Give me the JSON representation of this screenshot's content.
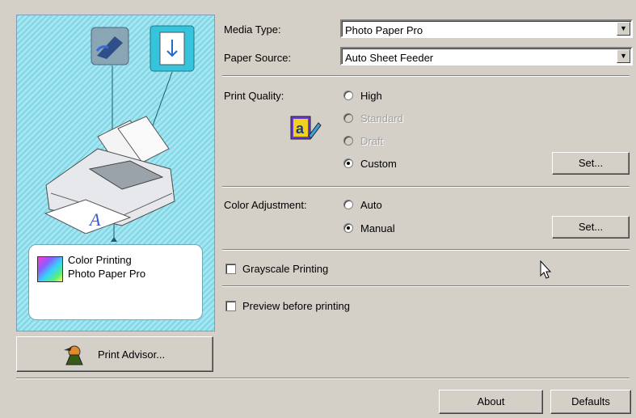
{
  "preview": {
    "info_line1": "Color Printing",
    "info_line2": "Photo Paper Pro",
    "print_advisor_label": "Print Advisor..."
  },
  "media_type": {
    "label": "Media Type:",
    "value": "Photo Paper Pro"
  },
  "paper_source": {
    "label": "Paper Source:",
    "value": "Auto Sheet Feeder"
  },
  "print_quality": {
    "label": "Print Quality:",
    "options": [
      "High",
      "Standard",
      "Draft",
      "Custom"
    ],
    "selected": "Custom",
    "set_label": "Set..."
  },
  "color_adjustment": {
    "label": "Color Adjustment:",
    "options": [
      "Auto",
      "Manual"
    ],
    "selected": "Manual",
    "set_label": "Set..."
  },
  "grayscale_label": "Grayscale Printing",
  "preview_label": "Preview before printing",
  "footer": {
    "about_label": "About",
    "defaults_label": "Defaults"
  }
}
